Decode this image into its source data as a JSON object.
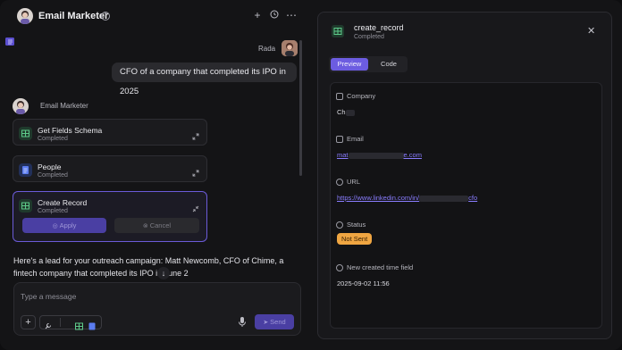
{
  "header": {
    "title": "Email Marketer",
    "actions": [
      "plus-icon",
      "history-icon",
      "more-icon"
    ]
  },
  "chat": {
    "user_name": "Rada",
    "user_message": "CFO of a company that completed its IPO in 2025",
    "agent_name": "Email Marketer",
    "tool_cards": [
      {
        "title": "Get Fields Schema",
        "status": "Completed"
      },
      {
        "title": "People",
        "status": "Completed"
      },
      {
        "title": "Create Record",
        "status": "Completed"
      }
    ],
    "apply_label": "Apply",
    "cancel_label": "Cancel",
    "reply": "Here's a lead for your outreach campaign: Matt Newcomb, CFO of Chime, a fintech company that completed its IPO in June 2"
  },
  "composer": {
    "placeholder": "Type a message",
    "send_label": "Send"
  },
  "panel": {
    "title": "create_record",
    "subtitle": "Completed",
    "tabs": [
      "Preview",
      "Code"
    ],
    "fields": {
      "company_label": "Company",
      "company_value": "Ch",
      "email_label": "Email",
      "email_prefix": "mat",
      "email_suffix": "e.com",
      "url_label": "URL",
      "url_prefix": "https://www.linkedin.com/in/",
      "url_suffix": "cfo",
      "status_label": "Status",
      "status_value": "Not Sent",
      "created_label": "New created time field",
      "created_value": "2025-09-02 11:56"
    }
  },
  "colors": {
    "accent": "#6c5ce0",
    "status_badge": "#f0a642",
    "link": "#8a7dff"
  }
}
